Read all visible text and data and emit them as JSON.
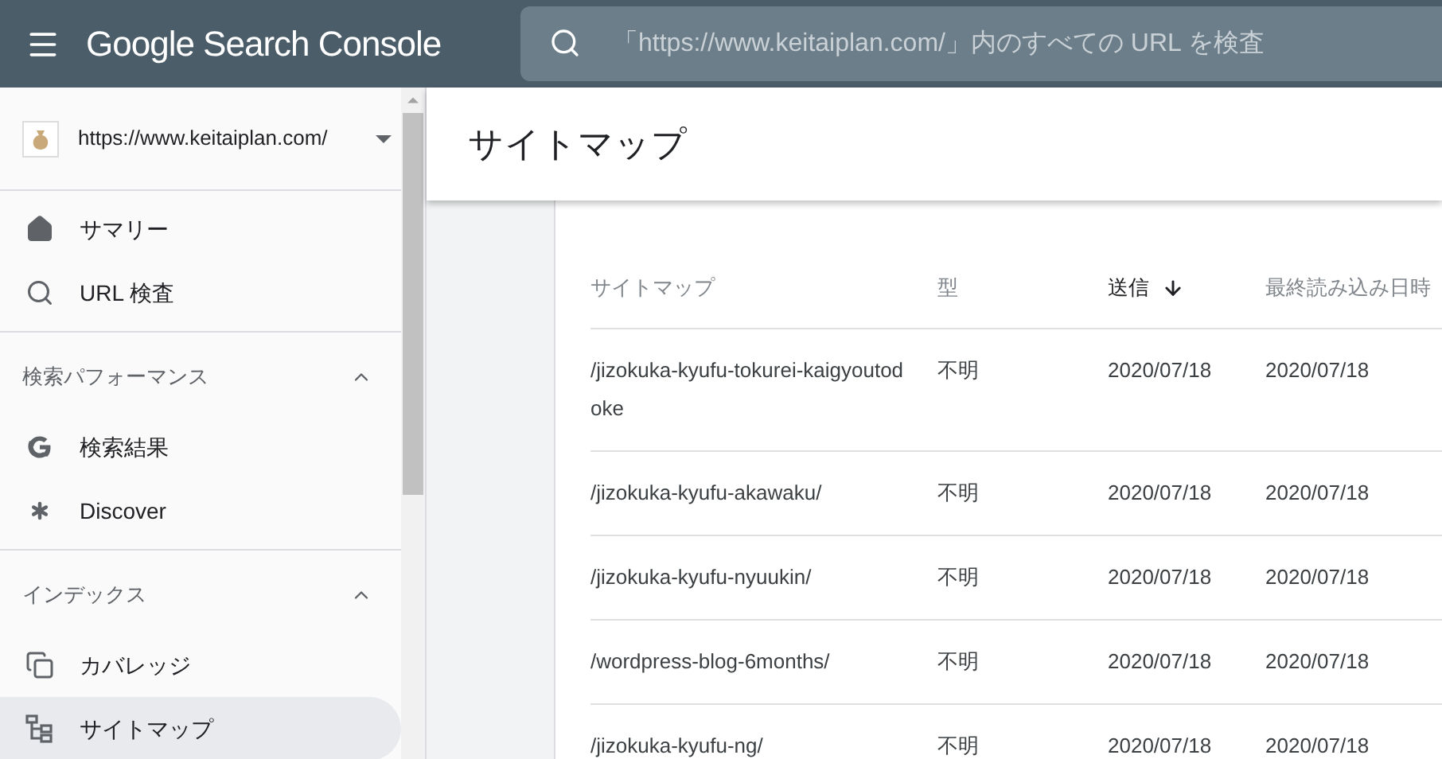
{
  "header": {
    "title": "Google Search Console",
    "search": {
      "placeholder": "「https://www.keitaiplan.com/」内のすべての URL を検査"
    }
  },
  "sidebar": {
    "property": "https://www.keitaiplan.com/",
    "sections": [
      {
        "items": [
          {
            "label": "サマリー",
            "selected": false
          },
          {
            "label": "URL 検査",
            "selected": false
          }
        ]
      },
      {
        "heading": "検索パフォーマンス",
        "expanded": true,
        "items": [
          {
            "label": "検索結果",
            "selected": false
          },
          {
            "label": "Discover",
            "selected": false
          }
        ]
      },
      {
        "heading": "インデックス",
        "expanded": true,
        "items": [
          {
            "label": "カバレッジ",
            "selected": false
          },
          {
            "label": "サイトマップ",
            "selected": true
          }
        ]
      }
    ]
  },
  "page": {
    "title": "サイトマップ"
  },
  "table": {
    "columns": [
      {
        "label": "サイトマップ",
        "sorted": false
      },
      {
        "label": "型",
        "sorted": false
      },
      {
        "label": "送信",
        "sorted": true
      },
      {
        "label": "最終読み込み日時",
        "sorted": false
      }
    ],
    "rows": [
      [
        "/jizokuka-kyufu-tokurei-kaigyoutodoke",
        "不明",
        "2020/07/18",
        "2020/07/18"
      ],
      [
        "/jizokuka-kyufu-akawaku/",
        "不明",
        "2020/07/18",
        "2020/07/18"
      ],
      [
        "/jizokuka-kyufu-nyuukin/",
        "不明",
        "2020/07/18",
        "2020/07/18"
      ],
      [
        "/wordpress-blog-6months/",
        "不明",
        "2020/07/18",
        "2020/07/18"
      ],
      [
        "/jizokuka-kyufu-ng/",
        "不明",
        "2020/07/18",
        "2020/07/18"
      ]
    ]
  }
}
